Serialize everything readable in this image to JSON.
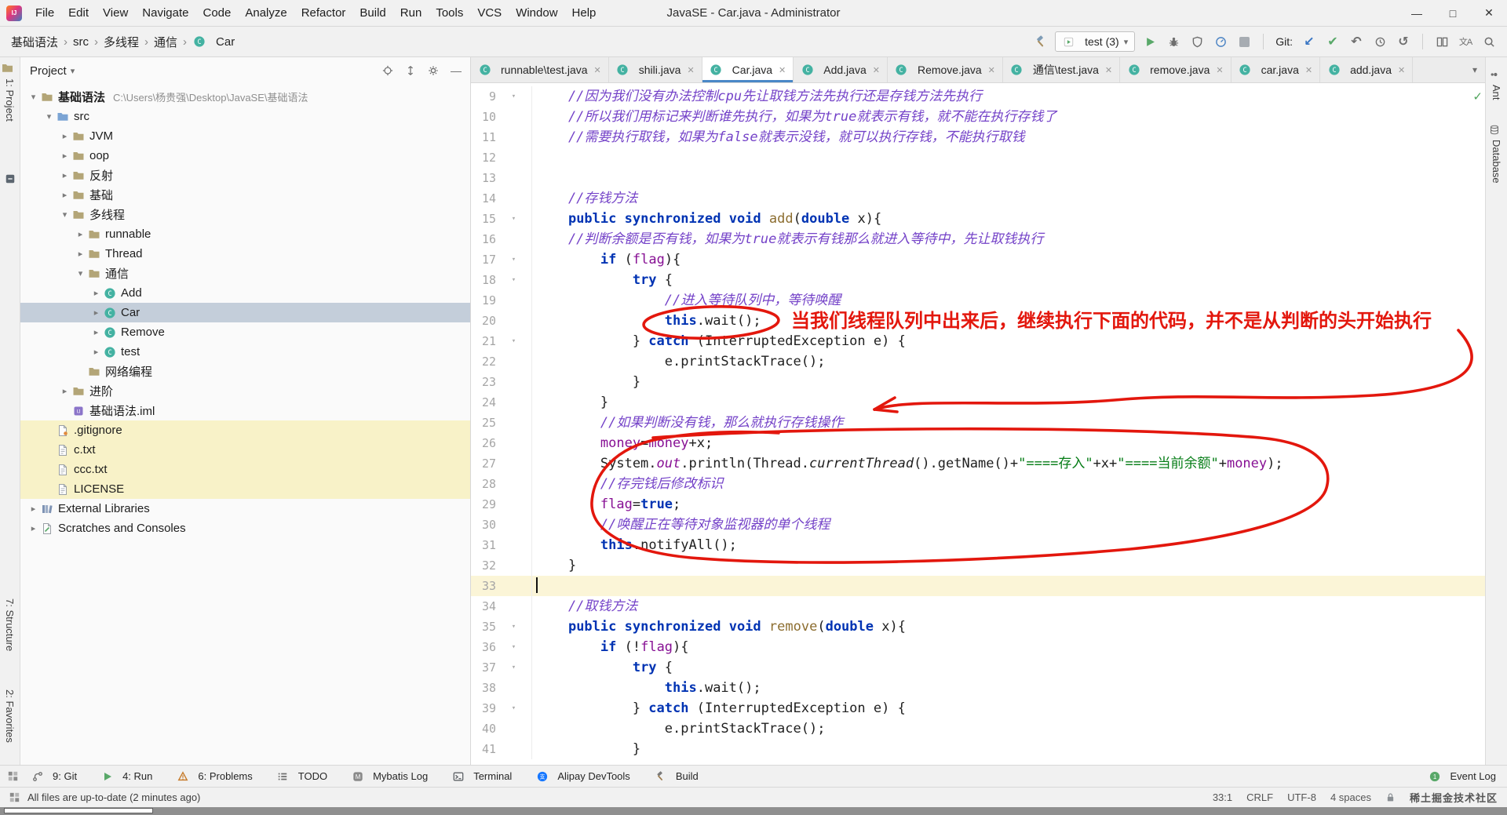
{
  "window": {
    "title": "JavaSE - Car.java - Administrator",
    "min": "—",
    "max": "□",
    "close": "✕"
  },
  "menu": [
    "File",
    "Edit",
    "View",
    "Navigate",
    "Code",
    "Analyze",
    "Refactor",
    "Build",
    "Run",
    "Tools",
    "VCS",
    "Window",
    "Help"
  ],
  "toolbar": {
    "breadcrumbs": [
      "基础语法",
      "src",
      "多线程",
      "通信",
      "Car"
    ],
    "run_config": "test (3)",
    "git_label": "Git:",
    "translate_label": "文A"
  },
  "tabs": [
    {
      "label": "runnable\\test.java"
    },
    {
      "label": "shili.java"
    },
    {
      "label": "Car.java",
      "active": true
    },
    {
      "label": "Add.java"
    },
    {
      "label": "Remove.java"
    },
    {
      "label": "通信\\test.java"
    },
    {
      "label": "remove.java"
    },
    {
      "label": "car.java"
    },
    {
      "label": "add.java"
    }
  ],
  "project": {
    "header": "Project",
    "tree": [
      {
        "level": 0,
        "chev": "open",
        "icon": "folder",
        "label": "基础语法",
        "extra": "C:\\Users\\杨贵强\\Desktop\\JavaSE\\基础语法",
        "bold": true
      },
      {
        "level": 1,
        "chev": "open",
        "icon": "src",
        "label": "src"
      },
      {
        "level": 2,
        "chev": "closed",
        "icon": "folder",
        "label": "JVM"
      },
      {
        "level": 2,
        "chev": "closed",
        "icon": "folder",
        "label": "oop"
      },
      {
        "level": 2,
        "chev": "closed",
        "icon": "folder",
        "label": "反射"
      },
      {
        "level": 2,
        "chev": "closed",
        "icon": "folder",
        "label": "基础"
      },
      {
        "level": 2,
        "chev": "open",
        "icon": "folder",
        "label": "多线程"
      },
      {
        "level": 3,
        "chev": "closed",
        "icon": "folder",
        "label": "runnable"
      },
      {
        "level": 3,
        "chev": "closed",
        "icon": "folder",
        "label": "Thread"
      },
      {
        "level": 3,
        "chev": "open",
        "icon": "folder",
        "label": "通信"
      },
      {
        "level": 4,
        "chev": "closed",
        "icon": "class",
        "label": "Add"
      },
      {
        "level": 4,
        "chev": "closed",
        "icon": "class",
        "label": "Car",
        "selected": true
      },
      {
        "level": 4,
        "chev": "closed",
        "icon": "class",
        "label": "Remove"
      },
      {
        "level": 4,
        "chev": "closed",
        "icon": "class",
        "label": "test"
      },
      {
        "level": 3,
        "chev": "none",
        "icon": "folder",
        "label": "网络编程"
      },
      {
        "level": 2,
        "chev": "closed",
        "icon": "folder",
        "label": "进阶"
      },
      {
        "level": 2,
        "chev": "none",
        "icon": "iml",
        "label": "基础语法.iml"
      },
      {
        "level": 1,
        "chev": "none",
        "icon": "gitignore",
        "label": ".gitignore",
        "changed": true
      },
      {
        "level": 1,
        "chev": "none",
        "icon": "txt",
        "label": "c.txt",
        "changed": true
      },
      {
        "level": 1,
        "chev": "none",
        "icon": "txt",
        "label": "ccc.txt",
        "changed": true
      },
      {
        "level": 1,
        "chev": "none",
        "icon": "txt",
        "label": "LICENSE",
        "changed": true
      },
      {
        "level": 0,
        "chev": "closed",
        "icon": "lib",
        "label": "External Libraries"
      },
      {
        "level": 0,
        "chev": "closed",
        "icon": "scratch",
        "label": "Scratches and Consoles"
      }
    ]
  },
  "editor": {
    "current_line": 33,
    "lines": [
      {
        "n": 9,
        "fold": true,
        "t": [
          [
            "cm",
            "    //因为我们没有办法控制cpu先让取钱方法先执行还是存钱方法先执行"
          ]
        ]
      },
      {
        "n": 10,
        "t": [
          [
            "cm",
            "    //所以我们用标记来判断谁先执行，如果为true就表示有钱，就不能在执行存钱了"
          ]
        ]
      },
      {
        "n": 11,
        "t": [
          [
            "cm",
            "    //需要执行取钱，如果为false就表示没钱，就可以执行存钱，不能执行取钱"
          ]
        ]
      },
      {
        "n": 12,
        "t": []
      },
      {
        "n": 13,
        "t": []
      },
      {
        "n": 14,
        "t": [
          [
            "cm",
            "    //存钱方法"
          ]
        ]
      },
      {
        "n": 15,
        "fold": true,
        "t": [
          [
            "pl",
            "    "
          ],
          [
            "kw",
            "public"
          ],
          [
            "pl",
            " "
          ],
          [
            "kw",
            "synchronized"
          ],
          [
            "pl",
            " "
          ],
          [
            "kw",
            "void"
          ],
          [
            "pl",
            " "
          ],
          [
            "mth",
            "add"
          ],
          [
            "pl",
            "("
          ],
          [
            "kw",
            "double"
          ],
          [
            "pl",
            " x){"
          ]
        ]
      },
      {
        "n": 16,
        "t": [
          [
            "cm",
            "    //判断余额是否有钱，如果为true就表示有钱那么就进入等待中，先让取钱执行"
          ]
        ]
      },
      {
        "n": 17,
        "fold": true,
        "t": [
          [
            "pl",
            "        "
          ],
          [
            "kw",
            "if"
          ],
          [
            "pl",
            " ("
          ],
          [
            "fld",
            "flag"
          ],
          [
            "pl",
            "){"
          ]
        ]
      },
      {
        "n": 18,
        "fold": true,
        "t": [
          [
            "pl",
            "            "
          ],
          [
            "kw",
            "try"
          ],
          [
            "pl",
            " {"
          ]
        ]
      },
      {
        "n": 19,
        "t": [
          [
            "cm",
            "                //进入等待队列中，等待唤醒"
          ]
        ]
      },
      {
        "n": 20,
        "t": [
          [
            "pl",
            "                "
          ],
          [
            "kw",
            "this"
          ],
          [
            "pl",
            ".wait();"
          ]
        ]
      },
      {
        "n": 21,
        "fold": true,
        "t": [
          [
            "pl",
            "            } "
          ],
          [
            "kw",
            "catch"
          ],
          [
            "pl",
            " (InterruptedException e) {"
          ]
        ]
      },
      {
        "n": 22,
        "t": [
          [
            "pl",
            "                e.printStackTrace();"
          ]
        ]
      },
      {
        "n": 23,
        "t": [
          [
            "pl",
            "            }"
          ]
        ]
      },
      {
        "n": 24,
        "t": [
          [
            "pl",
            "        }"
          ]
        ]
      },
      {
        "n": 25,
        "t": [
          [
            "cm",
            "        //如果判断没有钱，那么就执行存钱操作"
          ]
        ]
      },
      {
        "n": 26,
        "t": [
          [
            "pl",
            "        "
          ],
          [
            "fld",
            "money"
          ],
          [
            "pl",
            "="
          ],
          [
            "fld",
            "money"
          ],
          [
            "pl",
            "+x;"
          ]
        ]
      },
      {
        "n": 27,
        "t": [
          [
            "pl",
            "        System."
          ],
          [
            "fldit",
            "out"
          ],
          [
            "pl",
            ".println(Thread."
          ],
          [
            "it",
            "currentThread"
          ],
          [
            "pl",
            "().getName()+"
          ],
          [
            "str",
            "\"====存入\""
          ],
          [
            "pl",
            "+x+"
          ],
          [
            "str",
            "\"====当前余额\""
          ],
          [
            "pl",
            "+"
          ],
          [
            "fld",
            "money"
          ],
          [
            "pl",
            ");"
          ]
        ]
      },
      {
        "n": 28,
        "t": [
          [
            "cm",
            "        //存完钱后修改标识"
          ]
        ]
      },
      {
        "n": 29,
        "t": [
          [
            "pl",
            "        "
          ],
          [
            "fld",
            "flag"
          ],
          [
            "pl",
            "="
          ],
          [
            "kw",
            "true"
          ],
          [
            "pl",
            ";"
          ]
        ]
      },
      {
        "n": 30,
        "t": [
          [
            "cm",
            "        //唤醒正在等待对象监视器的单个线程"
          ]
        ]
      },
      {
        "n": 31,
        "t": [
          [
            "pl",
            "        "
          ],
          [
            "kw",
            "this"
          ],
          [
            "pl",
            ".notifyAll();"
          ]
        ]
      },
      {
        "n": 32,
        "t": [
          [
            "pl",
            "    }"
          ]
        ]
      },
      {
        "n": 33,
        "t": []
      },
      {
        "n": 34,
        "t": [
          [
            "cm",
            "    //取钱方法"
          ]
        ]
      },
      {
        "n": 35,
        "fold": true,
        "t": [
          [
            "pl",
            "    "
          ],
          [
            "kw",
            "public"
          ],
          [
            "pl",
            " "
          ],
          [
            "kw",
            "synchronized"
          ],
          [
            "pl",
            " "
          ],
          [
            "kw",
            "void"
          ],
          [
            "pl",
            " "
          ],
          [
            "mth",
            "remove"
          ],
          [
            "pl",
            "("
          ],
          [
            "kw",
            "double"
          ],
          [
            "pl",
            " x){"
          ]
        ]
      },
      {
        "n": 36,
        "fold": true,
        "t": [
          [
            "pl",
            "        "
          ],
          [
            "kw",
            "if"
          ],
          [
            "pl",
            " (!"
          ],
          [
            "fld",
            "flag"
          ],
          [
            "pl",
            "){"
          ]
        ]
      },
      {
        "n": 37,
        "fold": true,
        "t": [
          [
            "pl",
            "            "
          ],
          [
            "kw",
            "try"
          ],
          [
            "pl",
            " {"
          ]
        ]
      },
      {
        "n": 38,
        "t": [
          [
            "pl",
            "                "
          ],
          [
            "kw",
            "this"
          ],
          [
            "pl",
            ".wait();"
          ]
        ]
      },
      {
        "n": 39,
        "fold": true,
        "t": [
          [
            "pl",
            "            } "
          ],
          [
            "kw",
            "catch"
          ],
          [
            "pl",
            " (InterruptedException e) {"
          ]
        ]
      },
      {
        "n": 40,
        "t": [
          [
            "pl",
            "                e.printStackTrace();"
          ]
        ]
      },
      {
        "n": 41,
        "t": [
          [
            "pl",
            "            }"
          ]
        ]
      }
    ]
  },
  "annotations": {
    "note": "当我们线程队列中出来后，继续执行下面的代码，并不是从判断的头开始执行",
    "color": "#E3170D"
  },
  "stripes": {
    "left": [
      "1: Project",
      "7: Structure",
      "2: Favorites"
    ],
    "right": [
      "Ant",
      "Database"
    ]
  },
  "bottom_bar": {
    "left": [
      {
        "icon": "git",
        "label": "9: Git"
      },
      {
        "icon": "run",
        "label": "4: Run"
      },
      {
        "icon": "problems",
        "label": "6: Problems"
      },
      {
        "icon": "todo",
        "label": "TODO"
      },
      {
        "icon": "mybatis",
        "label": "Mybatis Log"
      },
      {
        "icon": "terminal",
        "label": "Terminal"
      },
      {
        "icon": "alipay",
        "label": "Alipay DevTools"
      },
      {
        "icon": "build",
        "label": "Build"
      }
    ],
    "right": [
      {
        "icon": "event",
        "label": "Event Log"
      }
    ]
  },
  "status_bar": {
    "message": "All files are up-to-date (2 minutes ago)",
    "position": "33:1",
    "line_ending": "CRLF",
    "encoding": "UTF-8",
    "indent": "4 spaces",
    "watermark": "稀土掘金技术社区"
  },
  "editor_status": {
    "inspection_ok": "✓"
  },
  "colors": {
    "accent_red": "#E3170D",
    "class_icon": "#44B2A2",
    "selection": "#C4CEDA",
    "changed_file_bg": "#F8F2C8"
  }
}
